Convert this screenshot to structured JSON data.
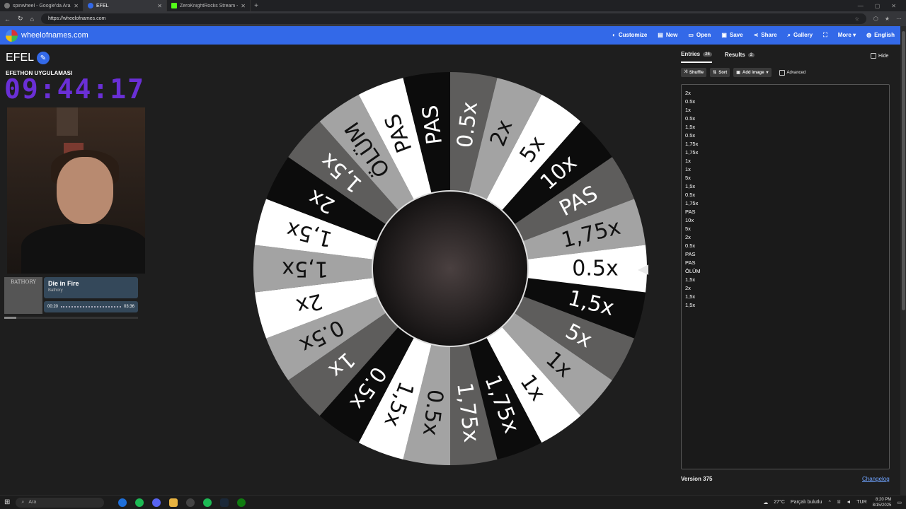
{
  "browser": {
    "tabs": [
      {
        "title": "spinwheel - Google'da Ara"
      },
      {
        "title": "EFEL"
      },
      {
        "title": "ZeroKnightRocks Stream - Watch"
      }
    ],
    "url": "https://wheelofnames.com"
  },
  "app": {
    "brand": "wheelofnames.com",
    "menu": [
      "Customize",
      "New",
      "Open",
      "Save",
      "Share",
      "Gallery",
      "More",
      "English"
    ],
    "icons": [
      "palette-icon",
      "file-icon",
      "folder-icon",
      "save-icon",
      "share-icon",
      "search-icon",
      "fullscreen-icon"
    ]
  },
  "wheel": {
    "title": "EFEL",
    "overlay_label": "EFETHON UYGULAMASI",
    "timer": "09:44:17"
  },
  "music": {
    "album_text": "BATHORY",
    "song": "Die in Fire",
    "artist": "Bathory",
    "elapsed": "00:20",
    "duration": "03:36",
    "progress": 0.09
  },
  "panel": {
    "tab_entries": "Entries",
    "entries_count": "26",
    "tab_results": "Results",
    "results_count": "2",
    "hide_label": "Hide",
    "shuffle": "Shuffle",
    "sort": "Sort",
    "add_image": "Add image",
    "advanced": "Advanced",
    "entries": [
      "2x",
      "0.5x",
      "1x",
      "0.5x",
      "1,5x",
      "0.5x",
      "1,75x",
      "1,75x",
      "1x",
      "1x",
      "5x",
      "1,5x",
      "0.5x",
      "1,75x",
      "PAS",
      "10x",
      "5x",
      "2x",
      "0.5x",
      "PAS",
      "PAS",
      "ÖLÜM",
      "1,5x",
      "2x",
      "1,5x",
      "1,5x"
    ],
    "version": "Version 375",
    "changelog": "Changelog"
  },
  "wheel_slices": [
    {
      "label": "1,5x",
      "color": "#0c0c0c"
    },
    {
      "label": "5x",
      "color": "#5e5d5c"
    },
    {
      "label": "1x",
      "color": "#a3a3a3"
    },
    {
      "label": "1x",
      "color": "#ffffff"
    },
    {
      "label": "1,75x",
      "color": "#0c0c0c"
    },
    {
      "label": "1,75x",
      "color": "#5e5d5c"
    },
    {
      "label": "0.5x",
      "color": "#a3a3a3"
    },
    {
      "label": "1,5x",
      "color": "#ffffff"
    },
    {
      "label": "0.5x",
      "color": "#0c0c0c"
    },
    {
      "label": "1x",
      "color": "#5e5d5c"
    },
    {
      "label": "0.5x",
      "color": "#a3a3a3"
    },
    {
      "label": "2x",
      "color": "#ffffff"
    },
    {
      "label": "1,5x",
      "color": "#a3a3a3"
    },
    {
      "label": "1,5x",
      "color": "#ffffff"
    },
    {
      "label": "2x",
      "color": "#0c0c0c"
    },
    {
      "label": "1,5x",
      "color": "#5e5d5c"
    },
    {
      "label": "ÖLÜM",
      "color": "#a3a3a3"
    },
    {
      "label": "PAS",
      "color": "#ffffff"
    },
    {
      "label": "PAS",
      "color": "#0c0c0c"
    },
    {
      "label": "0.5x",
      "color": "#5e5d5c"
    },
    {
      "label": "2x",
      "color": "#a3a3a3"
    },
    {
      "label": "5x",
      "color": "#ffffff"
    },
    {
      "label": "10x",
      "color": "#0c0c0c"
    },
    {
      "label": "PAS",
      "color": "#5e5d5c"
    },
    {
      "label": "1,75x",
      "color": "#a3a3a3"
    },
    {
      "label": "0.5x",
      "color": "#ffffff"
    }
  ],
  "taskbar": {
    "search": "Ara",
    "weather": "27°C",
    "weather_text": "Parçalı bulutlu",
    "lang": "TUR",
    "time": "8:20 PM",
    "date": "8/15/2025"
  }
}
